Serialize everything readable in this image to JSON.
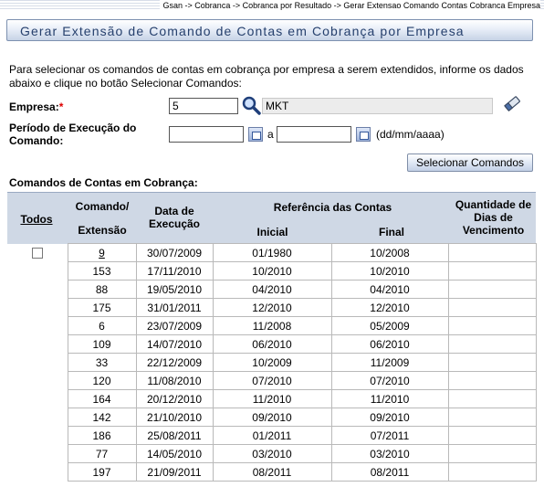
{
  "breadcrumb": "Gsan -> Cobranca -> Cobranca por Resultado -> Gerar Extensao Comando Contas Cobranca Empresa",
  "title": "Gerar Extensão de Comando de Contas em Cobrança por Empresa",
  "instructions": "Para selecionar os comandos de contas em cobrança por empresa a serem extendidos, informe os dados abaixo e clique no botão Selecionar Comandos:",
  "form": {
    "empresa_label": "Empresa:",
    "empresa_required": "*",
    "empresa_code": "5",
    "empresa_name": "MKT",
    "periodo_label_1": "Período de Execução do",
    "periodo_label_2": "Comando:",
    "periodo_inicio": "",
    "periodo_fim": "",
    "periodo_sep": "a",
    "date_format_hint": "(dd/mm/aaaa)",
    "select_button": "Selecionar Comandos"
  },
  "grid": {
    "section_title": "Comandos de Contas em Cobrança:",
    "headers": {
      "todos": "Todos",
      "comando_1": "Comando/",
      "comando_2": "Extensão",
      "data_1": "Data de",
      "data_2": "Execução",
      "referencia": "Referência das Contas",
      "inicial": "Inicial",
      "final": "Final",
      "qtd_1": "Quantidade de",
      "qtd_2": "Dias de",
      "qtd_3": "Vencimento"
    },
    "rows": [
      {
        "checkbox": true,
        "comando": "9",
        "link": true,
        "data": "30/07/2009",
        "inicial": "01/1980",
        "final": "10/2008",
        "dias": ""
      },
      {
        "checkbox": false,
        "comando": "153",
        "link": false,
        "data": "17/11/2010",
        "inicial": "10/2010",
        "final": "10/2010",
        "dias": ""
      },
      {
        "checkbox": false,
        "comando": "88",
        "link": false,
        "data": "19/05/2010",
        "inicial": "04/2010",
        "final": "04/2010",
        "dias": ""
      },
      {
        "checkbox": false,
        "comando": "175",
        "link": false,
        "data": "31/01/2011",
        "inicial": "12/2010",
        "final": "12/2010",
        "dias": ""
      },
      {
        "checkbox": false,
        "comando": "6",
        "link": false,
        "data": "23/07/2009",
        "inicial": "11/2008",
        "final": "05/2009",
        "dias": ""
      },
      {
        "checkbox": false,
        "comando": "109",
        "link": false,
        "data": "14/07/2010",
        "inicial": "06/2010",
        "final": "06/2010",
        "dias": ""
      },
      {
        "checkbox": false,
        "comando": "33",
        "link": false,
        "data": "22/12/2009",
        "inicial": "10/2009",
        "final": "11/2009",
        "dias": ""
      },
      {
        "checkbox": false,
        "comando": "120",
        "link": false,
        "data": "11/08/2010",
        "inicial": "07/2010",
        "final": "07/2010",
        "dias": ""
      },
      {
        "checkbox": false,
        "comando": "164",
        "link": false,
        "data": "20/12/2010",
        "inicial": "11/2010",
        "final": "11/2010",
        "dias": ""
      },
      {
        "checkbox": false,
        "comando": "142",
        "link": false,
        "data": "21/10/2010",
        "inicial": "09/2010",
        "final": "09/2010",
        "dias": ""
      },
      {
        "checkbox": false,
        "comando": "186",
        "link": false,
        "data": "25/08/2011",
        "inicial": "01/2011",
        "final": "07/2011",
        "dias": ""
      },
      {
        "checkbox": false,
        "comando": "77",
        "link": false,
        "data": "14/05/2010",
        "inicial": "03/2010",
        "final": "03/2010",
        "dias": ""
      },
      {
        "checkbox": false,
        "comando": "197",
        "link": false,
        "data": "21/09/2011",
        "inicial": "08/2011",
        "final": "08/2011",
        "dias": ""
      }
    ]
  }
}
